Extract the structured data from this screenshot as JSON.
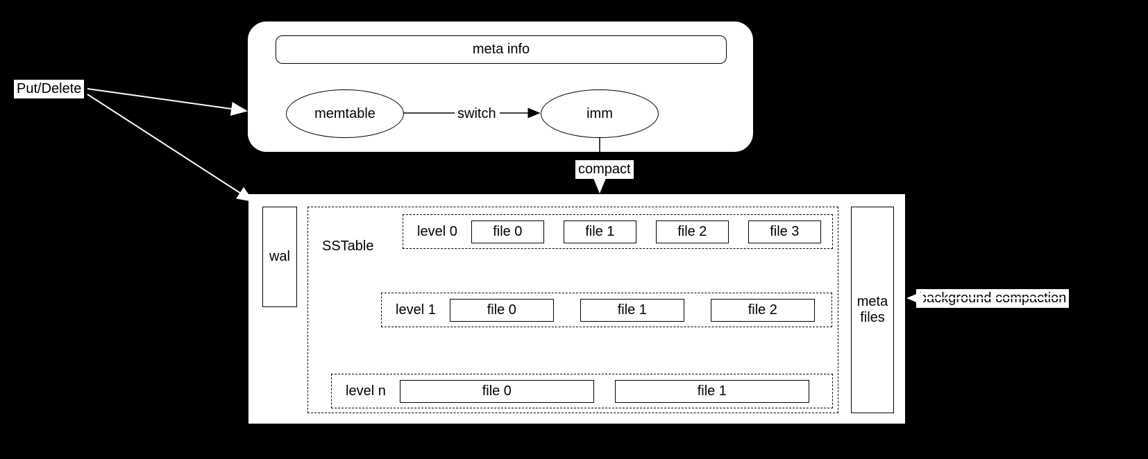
{
  "input_label": "Put/Delete",
  "memory_container": {
    "meta_info_label": "meta info",
    "memtable_label": "memtable",
    "switch_label": "switch",
    "imm_label": "imm"
  },
  "compact_label": "compact",
  "storage": {
    "wal_label": "wal",
    "sstable_label": "SSTable",
    "levels": [
      {
        "name": "level 0",
        "files": [
          "file 0",
          "file 1",
          "file 2",
          "file 3"
        ]
      },
      {
        "name": "level 1",
        "files": [
          "file 0",
          "file 1",
          "file 2"
        ]
      },
      {
        "name": "level n",
        "files": [
          "file 0",
          "file 1"
        ]
      }
    ],
    "meta_files_label": "meta\nfiles"
  },
  "background_compaction_label": "background compaction"
}
